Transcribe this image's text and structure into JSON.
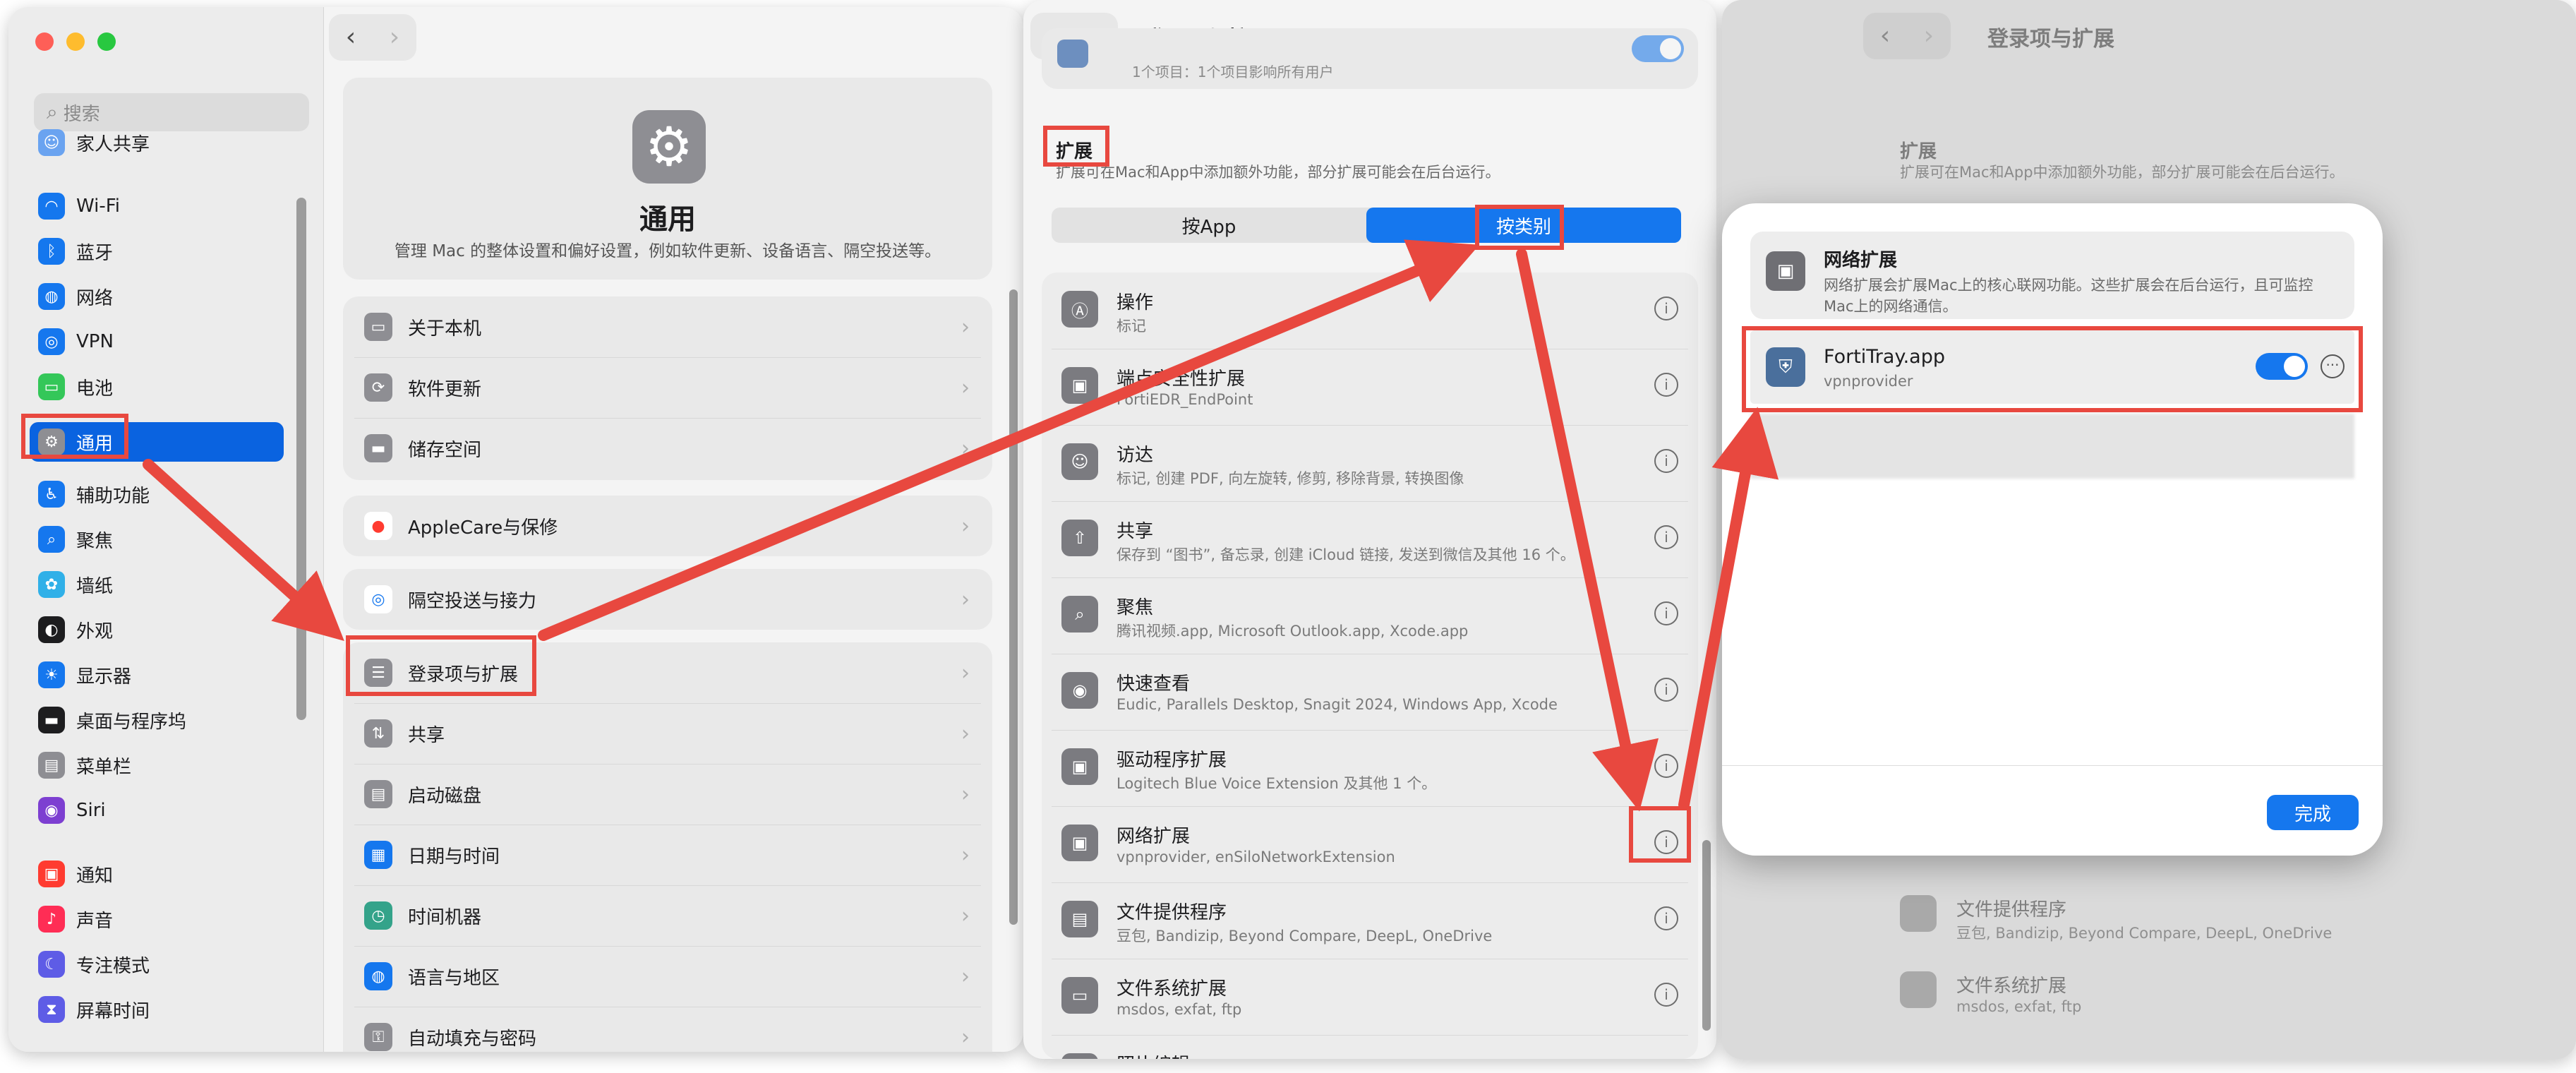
{
  "sidebar": {
    "search_placeholder": "搜索",
    "items": [
      {
        "label": "家人共享",
        "icon": "family-sharing-icon"
      },
      {
        "label": "Wi-Fi",
        "icon": "wifi-icon"
      },
      {
        "label": "蓝牙",
        "icon": "bluetooth-icon"
      },
      {
        "label": "网络",
        "icon": "network-icon"
      },
      {
        "label": "VPN",
        "icon": "vpn-icon"
      },
      {
        "label": "电池",
        "icon": "battery-icon"
      },
      {
        "label": "通用",
        "icon": "gear-icon",
        "selected": true
      },
      {
        "label": "辅助功能",
        "icon": "accessibility-icon"
      },
      {
        "label": "聚焦",
        "icon": "spotlight-icon"
      },
      {
        "label": "墙纸",
        "icon": "wallpaper-icon"
      },
      {
        "label": "外观",
        "icon": "appearance-icon"
      },
      {
        "label": "显示器",
        "icon": "display-icon"
      },
      {
        "label": "桌面与程序坞",
        "icon": "dock-icon"
      },
      {
        "label": "菜单栏",
        "icon": "menubar-icon"
      },
      {
        "label": "Siri",
        "icon": "siri-icon"
      },
      {
        "label": "通知",
        "icon": "notifications-icon"
      },
      {
        "label": "声音",
        "icon": "sound-icon"
      },
      {
        "label": "专注模式",
        "icon": "focus-icon"
      },
      {
        "label": "屏幕时间",
        "icon": "screentime-icon"
      }
    ]
  },
  "general": {
    "title": "通用",
    "description": "管理 Mac 的整体设置和偏好设置，例如软件更新、设备语言、隔空投送等。",
    "group1": [
      "关于本机",
      "软件更新",
      "储存空间"
    ],
    "group2": [
      "AppleCare与保修"
    ],
    "group3": [
      "隔空投送与接力"
    ],
    "group4": [
      "登录项与扩展",
      "共享",
      "启动磁盘",
      "日期与时间",
      "时间机器",
      "语言与地区",
      "自动填充与密码"
    ]
  },
  "extensions": {
    "window_title": "登录项与扩展",
    "top_row_title": "…app",
    "top_row_subtitle": "1个项目：1个项目影响所有用户",
    "section_title": "扩展",
    "section_desc": "扩展可在Mac和App中添加额外功能，部分扩展可能会在后台运行。",
    "tab_by_app": "按App",
    "tab_by_category": "按类别",
    "rows": [
      {
        "title": "操作",
        "sub": "标记"
      },
      {
        "title": "端点安全性扩展",
        "sub": "FortiEDR_EndPoint"
      },
      {
        "title": "访达",
        "sub": "标记, 创建 PDF, 向左旋转, 修剪, 移除背景, 转换图像"
      },
      {
        "title": "共享",
        "sub": "保存到 “图书”, 备忘录, 创建 iCloud 链接, 发送到微信及其他 16 个。"
      },
      {
        "title": "聚焦",
        "sub": "腾讯视频.app, Microsoft Outlook.app, Xcode.app"
      },
      {
        "title": "快速查看",
        "sub": "Eudic, Parallels Desktop, Snagit 2024, Windows App, Xcode"
      },
      {
        "title": "驱动程序扩展",
        "sub": "Logitech Blue Voice Extension 及其他 1 个。"
      },
      {
        "title": "网络扩展",
        "sub": "vpnprovider, enSiloNetworkExtension"
      },
      {
        "title": "文件提供程序",
        "sub": "豆包, Bandizip, Beyond Compare, DeepL, OneDrive"
      },
      {
        "title": "文件系统扩展",
        "sub": "msdos, exfat, ftp"
      },
      {
        "title": "照片编辑",
        "sub": ""
      }
    ]
  },
  "dialog": {
    "header_title": "网络扩展",
    "header_desc_1": "网络扩展会扩展Mac上的核心联网功能。这些扩展会在后台运行，且可监控",
    "header_desc_2": "Mac上的网络通信。",
    "app_name": "FortiTray.app",
    "app_sub": "vpnprovider",
    "toggle_on": true,
    "done_label": "完成"
  },
  "background_window": {
    "title": "登录项与扩展",
    "section_title": "扩展",
    "section_desc": "扩展可在Mac和App中添加额外功能，部分扩展可能会在后台运行。",
    "rows": [
      {
        "title": "文件提供程序",
        "sub": "豆包, Bandizip, Beyond Compare, DeepL, OneDrive"
      },
      {
        "title": "文件系统扩展",
        "sub": "msdos, exfat, ftp"
      }
    ]
  },
  "colors": {
    "accent": "#1577ee",
    "highlight": "#e8483f",
    "selected": "#0a63e0"
  }
}
